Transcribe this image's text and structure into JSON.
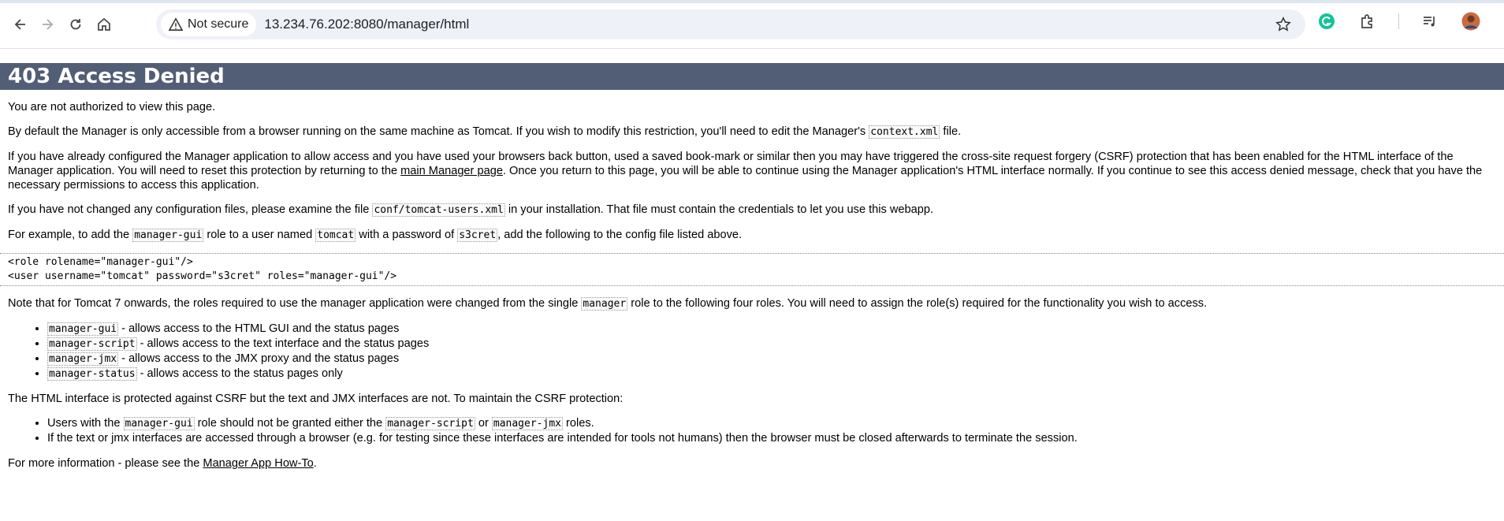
{
  "browser": {
    "security_label": "Not secure",
    "url": "13.234.76.202:8080/manager/html"
  },
  "page": {
    "title": "403 Access Denied",
    "p1": "You are not authorized to view this page.",
    "p2": {
      "before": "By default the Manager is only accessible from a browser running on the same machine as Tomcat. If you wish to modify this restriction, you'll need to edit the Manager's ",
      "code": "context.xml",
      "after": " file."
    },
    "p3": {
      "before": "If you have already configured the Manager application to allow access and you have used your browsers back button, used a saved book-mark or similar then you may have triggered the cross-site request forgery (CSRF) protection that has been enabled for the HTML interface of the Manager application. You will need to reset this protection by returning to the ",
      "link": "main Manager page",
      "after": ". Once you return to this page, you will be able to continue using the Manager application's HTML interface normally. If you continue to see this access denied message, check that you have the necessary permissions to access this application."
    },
    "p4": {
      "before": "If you have not changed any configuration files, please examine the file ",
      "code": "conf/tomcat-users.xml",
      "after": " in your installation. That file must contain the credentials to let you use this webapp."
    },
    "p5": {
      "t1": "For example, to add the ",
      "c1": "manager-gui",
      "t2": " role to a user named ",
      "c2": "tomcat",
      "t3": " with a password of ",
      "c3": "s3cret",
      "t4": ", add the following to the config file listed above."
    },
    "config_snippet": "<role rolename=\"manager-gui\"/>\n<user username=\"tomcat\" password=\"s3cret\" roles=\"manager-gui\"/>",
    "p6": {
      "before": "Note that for Tomcat 7 onwards, the roles required to use the manager application were changed from the single ",
      "code": "manager",
      "after": " role to the following four roles. You will need to assign the role(s) required for the functionality you wish to access."
    },
    "roles": [
      {
        "code": "manager-gui",
        "desc": " - allows access to the HTML GUI and the status pages"
      },
      {
        "code": "manager-script",
        "desc": " - allows access to the text interface and the status pages"
      },
      {
        "code": "manager-jmx",
        "desc": " - allows access to the JMX proxy and the status pages"
      },
      {
        "code": "manager-status",
        "desc": " - allows access to the status pages only"
      }
    ],
    "p7": "The HTML interface is protected against CSRF but the text and JMX interfaces are not. To maintain the CSRF protection:",
    "csrf1": {
      "t1": "Users with the ",
      "c1": "manager-gui",
      "t2": " role should not be granted either the ",
      "c2": "manager-script",
      "t3": " or ",
      "c3": "manager-jmx",
      "t4": " roles."
    },
    "csrf2": "If the text or jmx interfaces are accessed through a browser (e.g. for testing since these interfaces are intended for tools not humans) then the browser must be closed afterwards to terminate the session.",
    "p8": {
      "before": "For more information - please see the ",
      "link": "Manager App How-To",
      "after": "."
    }
  }
}
